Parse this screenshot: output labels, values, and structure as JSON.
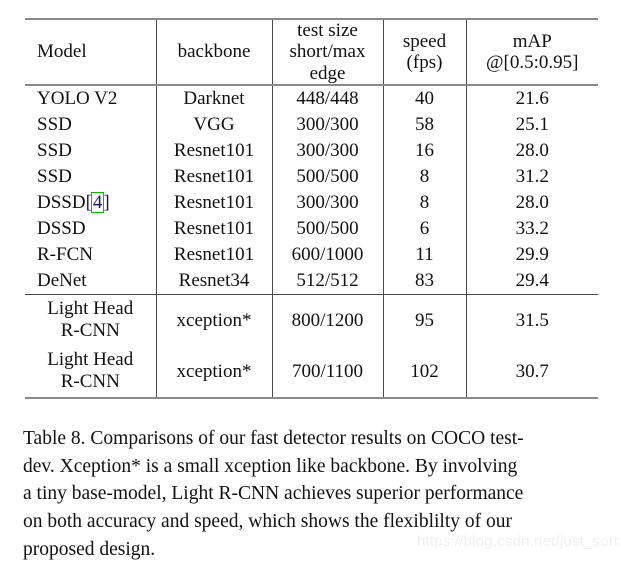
{
  "table": {
    "columns": [
      {
        "label": "Model",
        "align": "left"
      },
      {
        "label": "backbone",
        "align": "center"
      },
      {
        "label": "test size\nshort/max\nedge",
        "align": "center"
      },
      {
        "label": "speed\n(fps)",
        "align": "center"
      },
      {
        "label": "mAP\n@[0.5:0.95]",
        "align": "center"
      }
    ],
    "header": {
      "col1": "Model",
      "col2": "backbone",
      "col3_line1": "test size",
      "col3_line2": "short/max",
      "col3_line3": "edge",
      "col4_line1": "speed",
      "col4_line2": "(fps)",
      "col5_line1": "mAP",
      "col5_line2": "@[0.5:0.95]"
    },
    "rows": [
      {
        "model": "YOLO V2",
        "backbone": "Darknet",
        "test_size": "448/448",
        "speed": "40",
        "map": "21.6"
      },
      {
        "model": "SSD",
        "backbone": "VGG",
        "test_size": "300/300",
        "speed": "58",
        "map": "25.1"
      },
      {
        "model": "SSD",
        "backbone": "Resnet101",
        "test_size": "300/300",
        "speed": "16",
        "map": "28.0"
      },
      {
        "model": "SSD",
        "backbone": "Resnet101",
        "test_size": "500/500",
        "speed": "8",
        "map": "31.2"
      },
      {
        "model": "DSSD",
        "citation": "4",
        "citation_open": "[",
        "citation_close": "]",
        "backbone": "Resnet101",
        "test_size": "300/300",
        "speed": "8",
        "map": "28.0"
      },
      {
        "model": "DSSD",
        "backbone": "Resnet101",
        "test_size": "500/500",
        "speed": "6",
        "map": "33.2"
      },
      {
        "model": "R-FCN",
        "backbone": "Resnet101",
        "test_size": "600/1000",
        "speed": "11",
        "map": "29.9"
      },
      {
        "model": "DeNet",
        "backbone": "Resnet34",
        "test_size": "512/512",
        "speed": "83",
        "map": "29.4"
      }
    ],
    "highlight_rows": [
      {
        "model_line1": "Light Head",
        "model_line2": "R-CNN",
        "backbone": "xception*",
        "test_size": "800/1200",
        "speed": "95",
        "map": "31.5"
      },
      {
        "model_line1": "Light Head",
        "model_line2": "R-CNN",
        "backbone": "xception*",
        "test_size": "700/1100",
        "speed": "102",
        "map": "30.7"
      }
    ]
  },
  "caption": {
    "line1": "Table 8. Comparisons of our fast detector results on COCO test-",
    "line2": "dev.  Xception* is a small xception like backbone.  By involving",
    "line3": "a tiny base-model, Light R-CNN achieves superior performance",
    "line4": "on both accuracy and speed, which shows the flexiblilty of our",
    "line5": "proposed design."
  },
  "watermark": {
    "text": "https://blog.csdn.net/just_sort"
  },
  "colors": {
    "rule": "#8a8a8a",
    "divider": "#4a4a4a",
    "citation_box": "#00c000",
    "citation_text": "#151b54",
    "watermark": "#f0f0f0",
    "text": "#111111"
  }
}
